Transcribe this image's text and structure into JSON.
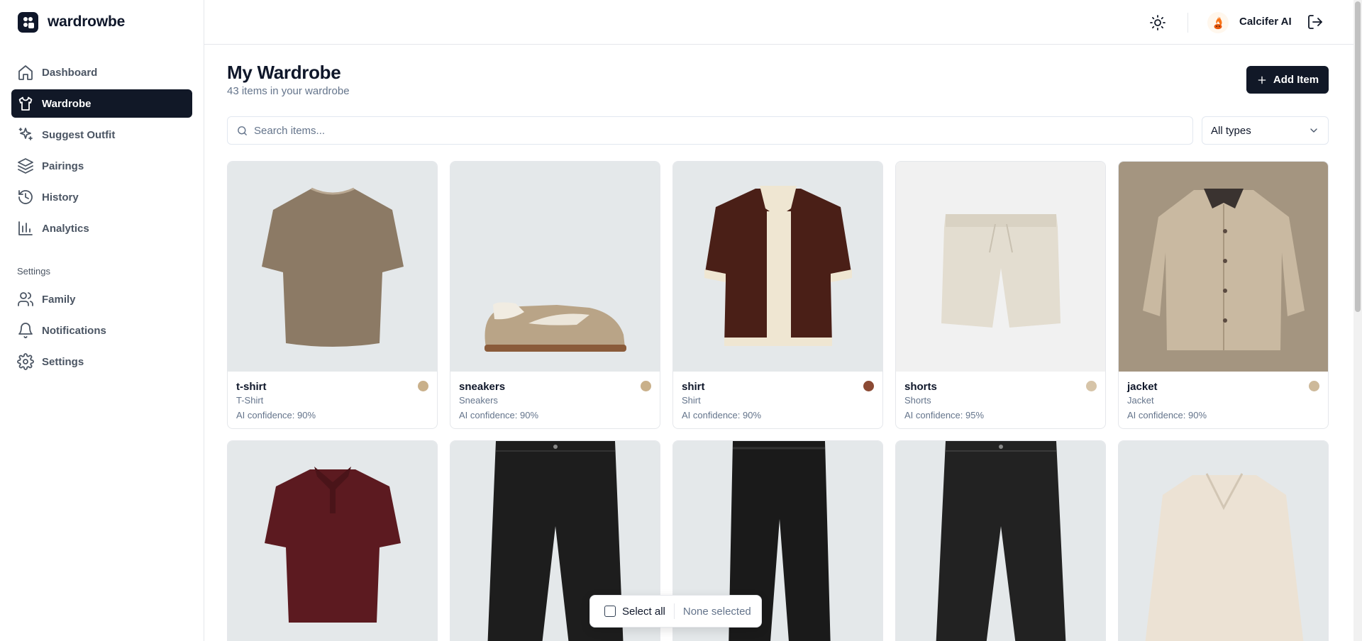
{
  "app": {
    "name": "wardrowbe"
  },
  "sidebar": {
    "items": [
      {
        "label": "Dashboard",
        "icon": "home-icon"
      },
      {
        "label": "Wardrobe",
        "icon": "shirt-icon",
        "active": true
      },
      {
        "label": "Suggest Outfit",
        "icon": "sparkles-icon"
      },
      {
        "label": "Pairings",
        "icon": "layers-icon"
      },
      {
        "label": "History",
        "icon": "history-icon"
      },
      {
        "label": "Analytics",
        "icon": "bar-chart-icon"
      }
    ],
    "settings_title": "Settings",
    "settings_items": [
      {
        "label": "Family",
        "icon": "users-icon"
      },
      {
        "label": "Notifications",
        "icon": "bell-icon"
      },
      {
        "label": "Settings",
        "icon": "gear-icon"
      }
    ]
  },
  "header": {
    "user_name": "Calcifer AI",
    "theme_icon": "sun-icon",
    "logout_icon": "logout-icon"
  },
  "page": {
    "title": "My Wardrobe",
    "subtitle": "43 items in your wardrobe",
    "add_button": "Add Item",
    "search_placeholder": "Search items...",
    "type_filter": "All types"
  },
  "items": [
    {
      "name": "t-shirt",
      "type": "T-Shirt",
      "confidence": "AI confidence: 90%",
      "color": "#c9b08a"
    },
    {
      "name": "sneakers",
      "type": "Sneakers",
      "confidence": "AI confidence: 90%",
      "color": "#c9b08a"
    },
    {
      "name": "shirt",
      "type": "Shirt",
      "confidence": "AI confidence: 90%",
      "color": "#8b4a34"
    },
    {
      "name": "shorts",
      "type": "Shorts",
      "confidence": "AI confidence: 95%",
      "color": "#d6c4a8"
    },
    {
      "name": "jacket",
      "type": "Jacket",
      "confidence": "AI confidence: 90%",
      "color": "#cdb99a"
    },
    {
      "name": "",
      "type": "",
      "confidence": "",
      "color": "#6b1f24"
    },
    {
      "name": "",
      "type": "",
      "confidence": "",
      "color": "#1b1b1b"
    },
    {
      "name": "",
      "type": "",
      "confidence": "",
      "color": "#1b1b1b"
    },
    {
      "name": "",
      "type": "",
      "confidence": "",
      "color": "#1b1b1b"
    },
    {
      "name": "",
      "type": "",
      "confidence": "",
      "color": "#ece2d4"
    }
  ],
  "selection_bar": {
    "select_all": "Select all",
    "status": "None selected"
  }
}
